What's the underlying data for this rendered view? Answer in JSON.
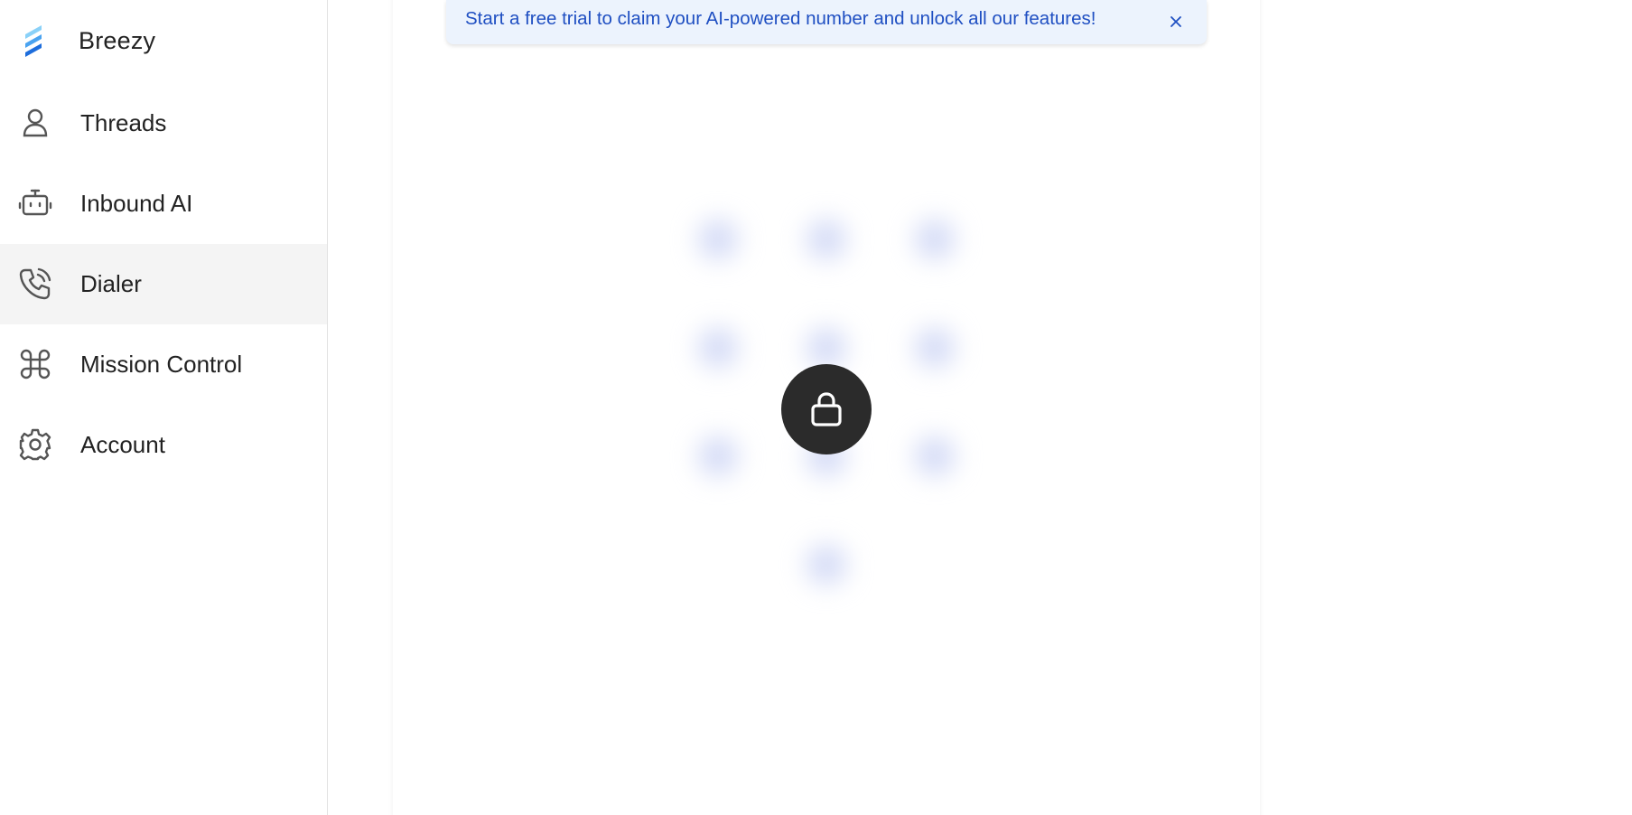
{
  "sidebar": {
    "brand": {
      "name": "Breezy",
      "logo_icon": "breezy-logo-icon",
      "logo_colors": [
        "#6fc4f6",
        "#3e95ee",
        "#1b66d8"
      ]
    },
    "items": [
      {
        "label": "Threads",
        "icon": "person-icon",
        "active": false
      },
      {
        "label": "Inbound AI",
        "icon": "robot-icon",
        "active": false
      },
      {
        "label": "Dialer",
        "icon": "phone-icon",
        "active": true
      },
      {
        "label": "Mission Control",
        "icon": "command-icon",
        "active": false
      },
      {
        "label": "Account",
        "icon": "gear-icon",
        "active": false
      }
    ]
  },
  "banner": {
    "text": "Start a free trial to claim your AI-powered number and unlock all our features!",
    "close_icon": "close-icon",
    "text_color": "#1f4fc2",
    "background": "#ecf3fd"
  },
  "dialer": {
    "locked": true,
    "lock_icon": "lock-icon",
    "keypad_keys": [
      "1",
      "2",
      "3",
      "4",
      "5",
      "6",
      "7",
      "8",
      "9",
      "0"
    ],
    "keypad_blurred": true
  },
  "colors": {
    "active_nav_bg": "#f4f4f4",
    "lock_button_bg": "#2b2b2b",
    "key_blur": "#d3daf6"
  }
}
